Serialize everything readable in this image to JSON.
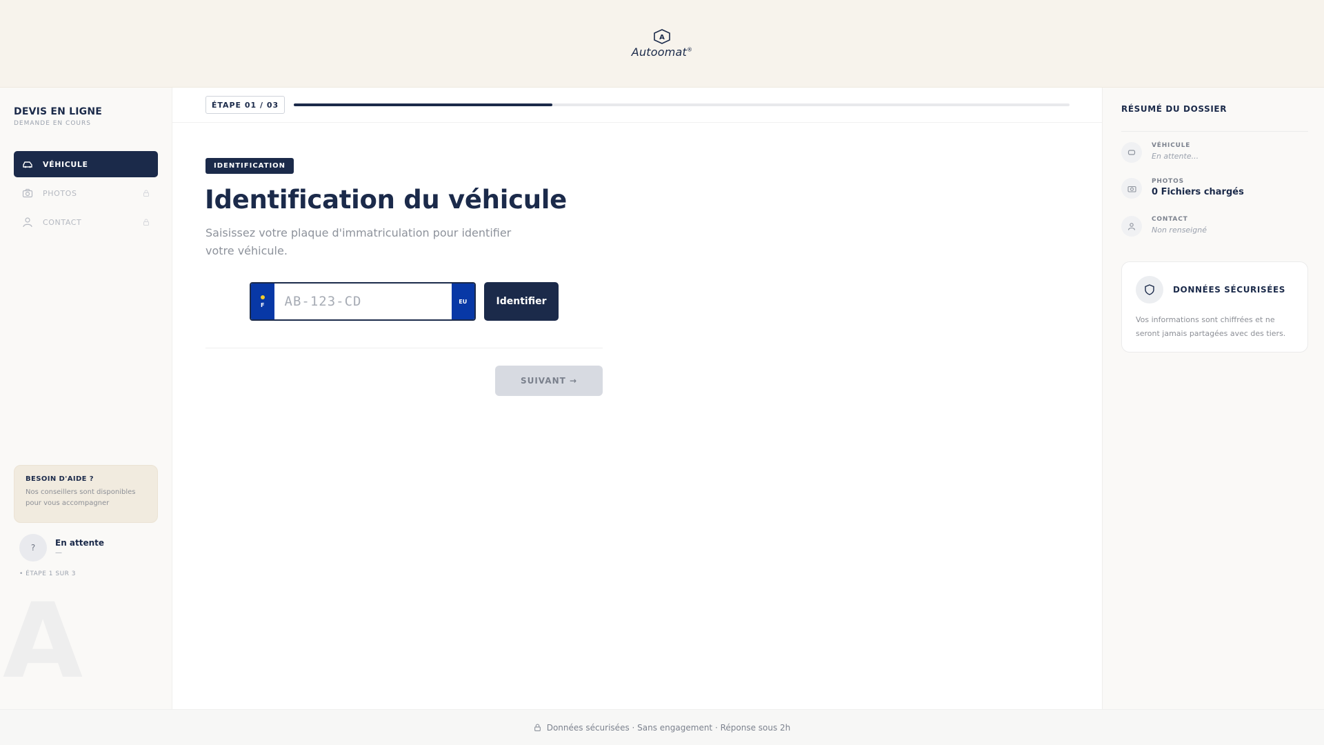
{
  "brand": {
    "name": "Autoomat",
    "mark": "A"
  },
  "sidebar": {
    "title": "DEVIS EN LIGNE",
    "subtitle": "DEMANDE EN COURS",
    "items": [
      {
        "label": "VÉHICULE",
        "icon": "car-icon",
        "active": true
      },
      {
        "label": "PHOTOS",
        "icon": "camera-icon",
        "locked": true
      },
      {
        "label": "CONTACT",
        "icon": "user-icon",
        "locked": true
      }
    ],
    "help": {
      "title": "BESOIN D'AIDE ?",
      "text": "Nos conseillers sont disponibles pour vous accompagner"
    },
    "status": {
      "avatar": "?",
      "title": "En attente",
      "sub": "—"
    },
    "step_note": "• ÉTAPE 1 SUR 3",
    "watermark": "A"
  },
  "progress": {
    "label": "ÉTAPE 01 / 03",
    "fraction": 0.333
  },
  "main": {
    "pill": "IDENTIFICATION",
    "heading": "Identification du véhicule",
    "lead": "Saisissez votre plaque d'immatriculation pour identifier votre véhicule.",
    "plate": {
      "country": "F",
      "placeholder": "AB-123-CD",
      "value": "",
      "right_band": "EU"
    },
    "identify_label": "Identifier",
    "next_label": "SUIVANT →"
  },
  "summary": {
    "title": "RÉSUMÉ DU DOSSIER",
    "items": [
      {
        "label": "VÉHICULE",
        "value": "En attente...",
        "icon": "car-icon"
      },
      {
        "label": "PHOTOS",
        "value": "0 Fichiers chargés",
        "icon": "camera-icon"
      },
      {
        "label": "CONTACT",
        "value": "Non renseigné",
        "icon": "user-icon"
      }
    ],
    "secure": {
      "title": "DONNÉES SÉCURISÉES",
      "text": "Vos informations sont chiffrées et ne seront jamais partagées avec des tiers.",
      "icon": "shield-icon"
    }
  },
  "footer": {
    "text": "Données sécurisées · Sans engagement · Réponse sous 2h",
    "icon": "lock-icon"
  },
  "colors": {
    "navy": "#1b2a4a",
    "cream": "#f7f3ec",
    "plate_blue": "#0838a6",
    "plate_star": "#f3cc2b"
  }
}
